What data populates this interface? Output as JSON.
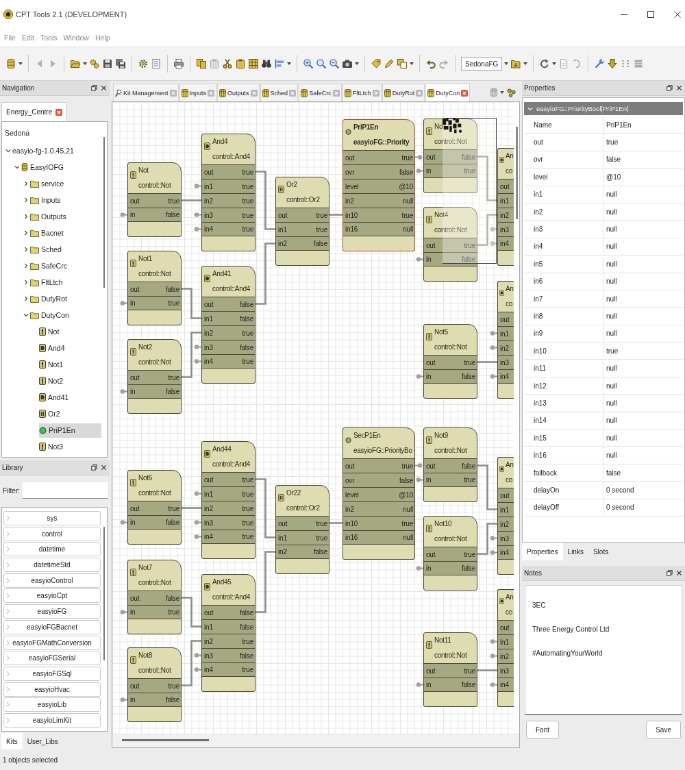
{
  "window": {
    "title": "CPT Tools 2.1 (DEVELOPMENT)"
  },
  "menu": [
    "File",
    "Edit",
    "Tools",
    "Window",
    "Help"
  ],
  "toolbar": [
    [
      {
        "kind": "app",
        "disabled": false,
        "dropdown": true
      }
    ],
    [
      {
        "kind": "back",
        "disabled": true,
        "dropdown": false
      },
      {
        "kind": "forward",
        "disabled": true,
        "dropdown": false
      }
    ],
    [
      {
        "kind": "open",
        "disabled": false,
        "dropdown": true
      },
      {
        "kind": "gears",
        "disabled": false,
        "dropdown": false
      },
      {
        "kind": "save",
        "disabled": false,
        "dropdown": false
      },
      {
        "kind": "saveall",
        "disabled": false,
        "dropdown": false
      }
    ],
    [
      {
        "kind": "connect",
        "disabled": false,
        "dropdown": false
      },
      {
        "kind": "list",
        "disabled": false,
        "dropdown": false
      }
    ],
    [
      {
        "kind": "print",
        "disabled": false,
        "dropdown": false
      }
    ],
    [
      {
        "kind": "copy",
        "disabled": false,
        "dropdown": false
      },
      {
        "kind": "paste",
        "disabled": true,
        "dropdown": false
      },
      {
        "kind": "cut",
        "disabled": false,
        "dropdown": false
      },
      {
        "kind": "paste",
        "disabled": false,
        "dropdown": false
      },
      {
        "kind": "table",
        "disabled": false,
        "dropdown": false
      },
      {
        "kind": "find",
        "disabled": false,
        "dropdown": false
      },
      {
        "kind": "align",
        "disabled": false,
        "dropdown": true
      }
    ],
    [
      {
        "kind": "zoomin",
        "disabled": false,
        "dropdown": false
      },
      {
        "kind": "zoomfit",
        "disabled": false,
        "dropdown": false
      },
      {
        "kind": "zoomout",
        "disabled": false,
        "dropdown": false
      },
      {
        "kind": "camera",
        "disabled": false,
        "dropdown": true
      }
    ],
    [
      {
        "kind": "tag",
        "disabled": false,
        "dropdown": false
      },
      {
        "kind": "pen",
        "disabled": false,
        "dropdown": false
      },
      {
        "kind": "duplicate",
        "disabled": false,
        "dropdown": true
      }
    ],
    [
      {
        "kind": "undo",
        "disabled": false,
        "dropdown": false
      },
      {
        "kind": "redo",
        "disabled": true,
        "dropdown": false
      }
    ],
    [
      {
        "kind": "select",
        "value": "SedonaFG",
        "disabled": false,
        "dropdown": true
      },
      {
        "kind": "build",
        "disabled": false,
        "dropdown": true
      }
    ],
    [
      {
        "kind": "refresh",
        "disabled": false,
        "dropdown": true
      },
      {
        "kind": "document",
        "disabled": true,
        "dropdown": false
      },
      {
        "kind": "hook",
        "disabled": true,
        "dropdown": false
      }
    ],
    [
      {
        "kind": "wrench",
        "disabled": false,
        "dropdown": false
      },
      {
        "kind": "down",
        "disabled": false,
        "dropdown": false
      },
      {
        "kind": "dots",
        "disabled": true,
        "dropdown": false
      },
      {
        "kind": "block",
        "disabled": true,
        "dropdown": false
      }
    ]
  ],
  "navigation": {
    "title": "Navigation",
    "tabs": [
      {
        "label": "Energy_Centre",
        "selected": true
      }
    ],
    "tree": [
      {
        "label": "Sedona",
        "selected": false,
        "children": [
          {
            "label": "easyio-fg-1.0.45.21",
            "expanded": true,
            "selected": false,
            "children": [
              {
                "label": "EasyIOFG",
                "kind": "app",
                "expanded": true,
                "selected": false,
                "children": [
                  {
                    "label": "service",
                    "kind": "folder",
                    "expanded": false,
                    "selected": false
                  },
                  {
                    "label": "Inputs",
                    "kind": "folder",
                    "expanded": false,
                    "selected": false
                  },
                  {
                    "label": "Outputs",
                    "kind": "folder",
                    "expanded": false,
                    "selected": false
                  },
                  {
                    "label": "Bacnet",
                    "kind": "folder",
                    "expanded": false,
                    "selected": false
                  },
                  {
                    "label": "Sched",
                    "kind": "folder",
                    "expanded": false,
                    "selected": false
                  },
                  {
                    "label": "SafeCrc",
                    "kind": "folder",
                    "expanded": false,
                    "selected": false
                  },
                  {
                    "label": "FltLtch",
                    "kind": "folder",
                    "expanded": false,
                    "selected": false
                  },
                  {
                    "label": "DutyRot",
                    "kind": "folder",
                    "expanded": false,
                    "selected": false
                  },
                  {
                    "label": "DutyCon",
                    "kind": "folder",
                    "expanded": true,
                    "selected": false,
                    "children": [
                      {
                        "label": "Not",
                        "kind": "not",
                        "selected": false
                      },
                      {
                        "label": "And4",
                        "kind": "and",
                        "selected": false
                      },
                      {
                        "label": "Not1",
                        "kind": "not",
                        "selected": false
                      },
                      {
                        "label": "Not2",
                        "kind": "not",
                        "selected": false
                      },
                      {
                        "label": "And41",
                        "kind": "and",
                        "selected": false
                      },
                      {
                        "label": "Or2",
                        "kind": "or",
                        "selected": false
                      },
                      {
                        "label": "PriP1En",
                        "kind": "priority",
                        "selected": true
                      },
                      {
                        "label": "Not3",
                        "kind": "not",
                        "selected": false
                      }
                    ]
                  }
                ]
              }
            ]
          }
        ]
      }
    ]
  },
  "library": {
    "title": "Library",
    "filter_label": "Filter:",
    "kits": [
      {
        "label": "sys",
        "expanded": false
      },
      {
        "label": "control",
        "expanded": false
      },
      {
        "label": "datetime",
        "expanded": false
      },
      {
        "label": "datetimeStd",
        "expanded": false
      },
      {
        "label": "easyioControl",
        "expanded": false
      },
      {
        "label": "easyioCpt",
        "expanded": false
      },
      {
        "label": "easyioFG",
        "expanded": false
      },
      {
        "label": "easyioFGBacnet",
        "expanded": false
      },
      {
        "label": "easyioFGMathConversion",
        "expanded": false
      },
      {
        "label": "easyioFGSerial",
        "expanded": false
      },
      {
        "label": "easyioFGSql",
        "expanded": false
      },
      {
        "label": "easyioHvac",
        "expanded": false
      },
      {
        "label": "easyioLib",
        "expanded": false
      },
      {
        "label": "easyioLimKit",
        "expanded": false
      }
    ],
    "tabs": [
      {
        "label": "Kits",
        "selected": true
      },
      {
        "label": "User_Libs",
        "selected": false
      }
    ]
  },
  "status_bar": "1 objects selected",
  "editor": {
    "tabs": [
      {
        "label": "Kit Management",
        "kind": "kit",
        "selected": false
      },
      {
        "label": "Inputs",
        "kind": "app",
        "selected": false
      },
      {
        "label": "Outputs",
        "kind": "app",
        "selected": false
      },
      {
        "label": "Sched",
        "kind": "app",
        "selected": false
      },
      {
        "label": "SafeCrc",
        "kind": "app",
        "selected": false
      },
      {
        "label": "FltLtch",
        "kind": "app",
        "selected": false
      },
      {
        "label": "DutyRot",
        "kind": "app",
        "selected": false
      },
      {
        "label": "DutyCon",
        "kind": "app",
        "selected": true
      }
    ],
    "nodes": [
      {
        "title": "Not",
        "type": "control::Not",
        "kind": "not",
        "selected": false,
        "slots": [
          {
            "name": "out",
            "value": "true",
            "linked": true
          },
          {
            "name": "in",
            "value": "false",
            "linked": false
          }
        ]
      },
      {
        "title": "And4",
        "type": "control::And4",
        "kind": "and",
        "selected": false,
        "slots": [
          {
            "name": "out",
            "value": "true",
            "linked": true
          },
          {
            "name": "in1",
            "value": "true",
            "linked": false
          },
          {
            "name": "in2",
            "value": "true",
            "linked": true
          },
          {
            "name": "in3",
            "value": "true",
            "linked": false
          },
          {
            "name": "in4",
            "value": "true",
            "linked": false
          }
        ]
      },
      {
        "title": "Not1",
        "type": "control::Not",
        "kind": "not",
        "selected": false,
        "slots": [
          {
            "name": "out",
            "value": "false",
            "linked": true
          },
          {
            "name": "in",
            "value": "true",
            "linked": false
          }
        ]
      },
      {
        "title": "And41",
        "type": "control::And4",
        "kind": "and",
        "selected": false,
        "slots": [
          {
            "name": "out",
            "value": "false",
            "linked": true
          },
          {
            "name": "in1",
            "value": "false",
            "linked": true
          },
          {
            "name": "in2",
            "value": "true",
            "linked": true
          },
          {
            "name": "in3",
            "value": "false",
            "linked": false
          },
          {
            "name": "in4",
            "value": "true",
            "linked": false
          }
        ]
      },
      {
        "title": "Not2",
        "type": "control::Not",
        "kind": "not",
        "selected": false,
        "slots": [
          {
            "name": "out",
            "value": "true",
            "linked": true
          },
          {
            "name": "in",
            "value": "false",
            "linked": false
          }
        ]
      },
      {
        "title": "Or2",
        "type": "control::Or2",
        "kind": "or",
        "selected": false,
        "slots": [
          {
            "name": "out",
            "value": "true",
            "linked": true
          },
          {
            "name": "in1",
            "value": "true",
            "linked": true
          },
          {
            "name": "in2",
            "value": "false",
            "linked": true
          }
        ]
      },
      {
        "title": "PriP1En",
        "type": "easyioFG::Priority",
        "kind": "priority",
        "selected": true,
        "slots": [
          {
            "name": "out",
            "value": "true",
            "linked": false
          },
          {
            "name": "ovr",
            "value": "false"
          },
          {
            "name": "level",
            "value": "@10"
          },
          {
            "name": "in2",
            "value": "null"
          },
          {
            "name": "in10",
            "value": "true",
            "linked": true
          },
          {
            "name": "in16",
            "value": "null"
          }
        ]
      },
      {
        "title": "No",
        "type": "control::Not",
        "kind": "not",
        "selected": false,
        "slots": [
          {
            "name": "out",
            "value": "false",
            "linked": true
          },
          {
            "name": "in",
            "value": "true",
            "linked": false
          }
        ]
      },
      {
        "title": "Not4",
        "type": "control::Not",
        "kind": "not",
        "selected": false,
        "slots": [
          {
            "name": "out",
            "value": "true",
            "linked": true
          },
          {
            "name": "in",
            "value": "false",
            "linked": false
          }
        ]
      },
      {
        "title": "Not5",
        "type": "control::Not",
        "kind": "not",
        "selected": false,
        "slots": [
          {
            "name": "out",
            "value": "true",
            "linked": true
          },
          {
            "name": "in",
            "value": "false",
            "linked": false
          }
        ]
      },
      {
        "title": "An",
        "type": "co",
        "kind": "and",
        "selected": false,
        "slots": [
          {
            "name": "out"
          },
          {
            "name": "in1",
            "linked": true
          },
          {
            "name": "in2",
            "linked": true
          },
          {
            "name": "in3",
            "linked": false
          },
          {
            "name": "in4",
            "linked": false
          }
        ]
      },
      {
        "title": "An",
        "type": "co",
        "kind": "and",
        "selected": false,
        "slots": [
          {
            "name": "out"
          },
          {
            "name": "in1",
            "linked": false
          },
          {
            "name": "in2",
            "linked": false
          },
          {
            "name": "in3",
            "linked": true
          },
          {
            "name": "in4",
            "linked": false
          }
        ]
      },
      {
        "title": "Not6",
        "type": "control::Not",
        "kind": "not",
        "selected": false,
        "slots": [
          {
            "name": "out",
            "value": "true",
            "linked": true
          },
          {
            "name": "in",
            "value": "false",
            "linked": false
          }
        ]
      },
      {
        "title": "And44",
        "type": "control::And4",
        "kind": "and",
        "selected": false,
        "slots": [
          {
            "name": "out",
            "value": "true",
            "linked": true
          },
          {
            "name": "in1",
            "value": "true",
            "linked": false
          },
          {
            "name": "in2",
            "value": "true",
            "linked": true
          },
          {
            "name": "in3",
            "value": "true",
            "linked": false
          },
          {
            "name": "in4",
            "value": "true",
            "linked": false
          }
        ]
      },
      {
        "title": "Not7",
        "type": "control::Not",
        "kind": "not",
        "selected": false,
        "slots": [
          {
            "name": "out",
            "value": "false",
            "linked": true
          },
          {
            "name": "in",
            "value": "true",
            "linked": false
          }
        ]
      },
      {
        "title": "And45",
        "type": "control::And4",
        "kind": "and",
        "selected": false,
        "slots": [
          {
            "name": "out",
            "value": "false",
            "linked": true
          },
          {
            "name": "in1",
            "value": "false",
            "linked": true
          },
          {
            "name": "in2",
            "value": "true",
            "linked": true
          },
          {
            "name": "in3",
            "value": "false",
            "linked": false
          },
          {
            "name": "in4",
            "value": "true",
            "linked": false
          }
        ]
      },
      {
        "title": "Not8",
        "type": "control::Not",
        "kind": "not",
        "selected": false,
        "slots": [
          {
            "name": "out",
            "value": "true",
            "linked": true
          },
          {
            "name": "in",
            "value": "false",
            "linked": false
          }
        ]
      },
      {
        "title": "Or22",
        "type": "control::Or2",
        "kind": "or",
        "selected": false,
        "slots": [
          {
            "name": "out",
            "value": "true",
            "linked": true
          },
          {
            "name": "in1",
            "value": "true",
            "linked": true
          },
          {
            "name": "in2",
            "value": "false",
            "linked": true
          }
        ]
      },
      {
        "title": "SecP1En",
        "type": "easyioFG::PriorityBo",
        "kind": "priority",
        "selected": false,
        "slots": [
          {
            "name": "out",
            "value": "true",
            "linked": false
          },
          {
            "name": "ovr",
            "value": "false"
          },
          {
            "name": "level",
            "value": "@10"
          },
          {
            "name": "in2",
            "value": "null"
          },
          {
            "name": "in10",
            "value": "true",
            "linked": true
          },
          {
            "name": "in16",
            "value": "null"
          }
        ]
      },
      {
        "title": "Not9",
        "type": "control::Not",
        "kind": "not",
        "selected": false,
        "slots": [
          {
            "name": "out",
            "value": "false",
            "linked": true
          },
          {
            "name": "in",
            "value": "true",
            "linked": false
          }
        ]
      },
      {
        "title": "Not10",
        "type": "control::Not",
        "kind": "not",
        "selected": false,
        "slots": [
          {
            "name": "out",
            "value": "true",
            "linked": true
          },
          {
            "name": "in",
            "value": "false",
            "linked": false
          }
        ]
      },
      {
        "title": "Not11",
        "type": "control::Not",
        "kind": "not",
        "selected": false,
        "slots": [
          {
            "name": "out",
            "value": "true",
            "linked": true
          },
          {
            "name": "in",
            "value": "false",
            "linked": false
          }
        ]
      },
      {
        "title": "An",
        "type": "co",
        "kind": "and",
        "selected": false,
        "slots": [
          {
            "name": "out"
          },
          {
            "name": "in1",
            "linked": true
          },
          {
            "name": "in2",
            "linked": true
          },
          {
            "name": "in3",
            "linked": false
          },
          {
            "name": "in4",
            "linked": false
          }
        ]
      },
      {
        "title": "An",
        "type": "co",
        "kind": "and",
        "selected": false,
        "slots": [
          {
            "name": "out"
          },
          {
            "name": "in1",
            "linked": false
          },
          {
            "name": "in2",
            "linked": false
          },
          {
            "name": "in3",
            "linked": true
          },
          {
            "name": "in4",
            "linked": false
          }
        ]
      }
    ]
  },
  "properties": {
    "title": "Properties",
    "group": "easyioFG::PriorityBool[PriP1En]",
    "expanded": true,
    "rows": [
      {
        "name": "Name",
        "value": "PriP1En"
      },
      {
        "name": "out",
        "value": "true"
      },
      {
        "name": "ovr",
        "value": "false"
      },
      {
        "name": "level",
        "value": "@10"
      },
      {
        "name": "in1",
        "value": "null"
      },
      {
        "name": "in2",
        "value": "null"
      },
      {
        "name": "in3",
        "value": "null"
      },
      {
        "name": "in4",
        "value": "null"
      },
      {
        "name": "in5",
        "value": "null"
      },
      {
        "name": "in6",
        "value": "null"
      },
      {
        "name": "in7",
        "value": "null"
      },
      {
        "name": "in8",
        "value": "null"
      },
      {
        "name": "in9",
        "value": "null"
      },
      {
        "name": "in10",
        "value": "true"
      },
      {
        "name": "in11",
        "value": "null"
      },
      {
        "name": "in12",
        "value": "null"
      },
      {
        "name": "in13",
        "value": "null"
      },
      {
        "name": "in14",
        "value": "null"
      },
      {
        "name": "in15",
        "value": "null"
      },
      {
        "name": "in16",
        "value": "null"
      },
      {
        "name": "fallback",
        "value": "false"
      },
      {
        "name": "delayOn",
        "value": "0 second"
      },
      {
        "name": "delayOff",
        "value": "0 second"
      }
    ],
    "tabs": [
      {
        "label": "Properties",
        "selected": true
      },
      {
        "label": "Links",
        "selected": false
      },
      {
        "label": "Slots",
        "selected": false
      }
    ]
  },
  "notes": {
    "title": "Notes",
    "lines": [
      "3EC",
      "Three Energy Control Ltd",
      "#AutomatingYourWorld"
    ],
    "buttons": [
      "Font",
      "Save"
    ]
  }
}
